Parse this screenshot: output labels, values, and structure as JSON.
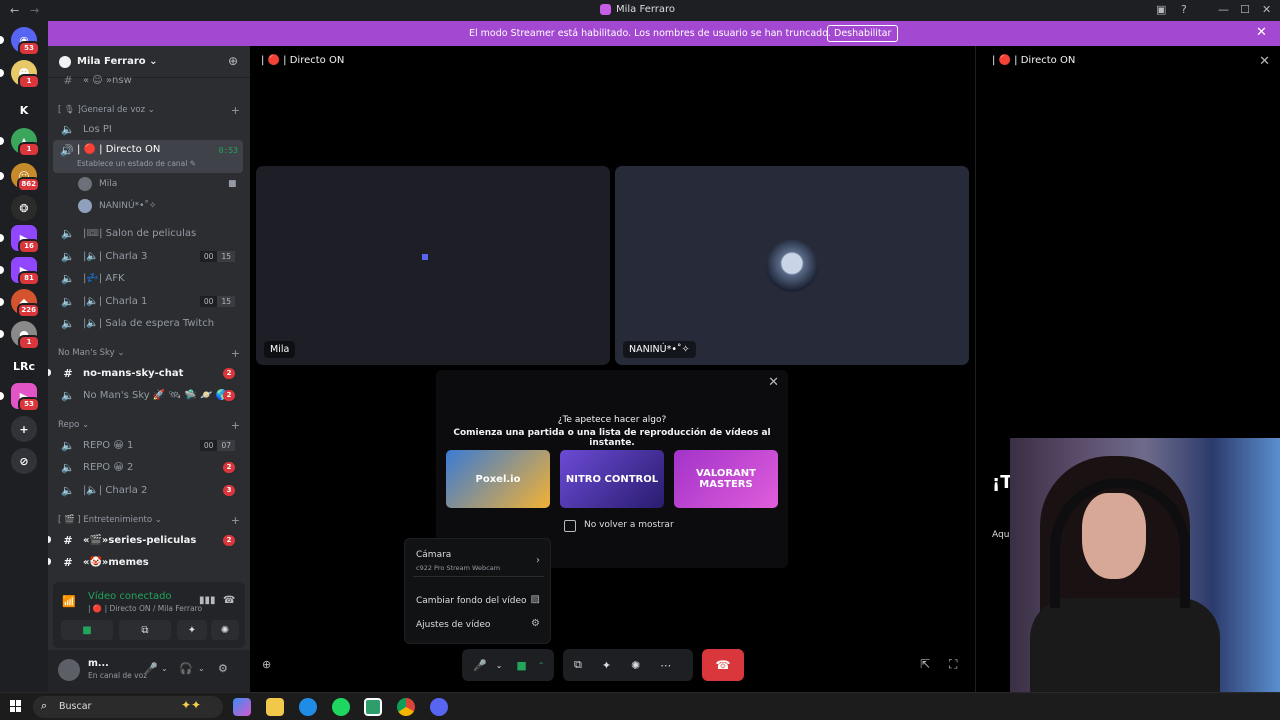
{
  "window": {
    "title": "Mila Ferraro",
    "back": "←",
    "forward": "→",
    "controls": [
      "▣",
      "?",
      "—",
      "☐",
      "✕"
    ]
  },
  "banner": {
    "text": "El modo Streamer está habilitado. Los nombres de usuario se han truncado.",
    "button": "Deshabilitar",
    "close": "✕"
  },
  "guilds": [
    {
      "label": "◉",
      "badge": "53",
      "color": "#5865f2"
    },
    {
      "label": "☻",
      "badge": "1",
      "color": "#e8c96a"
    },
    {
      "label": "K",
      "badge": "",
      "color": "#1e1f22"
    },
    {
      "label": "▲",
      "badge": "1",
      "color": "#3ba55c"
    },
    {
      "label": "☺",
      "badge": "862",
      "color": "#c58b2a"
    },
    {
      "label": "❂",
      "badge": "",
      "color": "#2b2b2b"
    },
    {
      "label": "▶",
      "badge": "16",
      "color": "#9146ff"
    },
    {
      "label": "▶",
      "badge": "81",
      "color": "#9146ff"
    },
    {
      "label": "◆",
      "badge": "226",
      "color": "#d3542e"
    },
    {
      "label": "●",
      "badge": "1",
      "color": "#8a8a8a"
    },
    {
      "label": "LRc",
      "badge": "",
      "color": "#1e1f22"
    },
    {
      "label": "▶",
      "badge": "53",
      "color": "#e355c7"
    },
    {
      "label": "+",
      "badge": "",
      "color": "#313338"
    },
    {
      "label": "⊘",
      "badge": "",
      "color": "#313338"
    }
  ],
  "server": {
    "name": "Mila Ferraro ⌄",
    "add_user": "⊕"
  },
  "channels_top": {
    "partial": "« ☺ »nsw"
  },
  "categories": {
    "general_voz": "[ 🎙 ]General de voz ⌄",
    "no_mans_sky": "No Man's Sky ⌄",
    "repo": "Repo ⌄",
    "entretenimiento": "[ 🎬 ] Entretenimiento ⌄"
  },
  "channels": {
    "los_pi": "Los PI",
    "directo_on": "| 🔴 | Directo ON",
    "directo_status": "Establece un estado de canal ✎",
    "directo_time": "0:53",
    "voice_users": [
      "Mila",
      "NANINÚ*•˚✧"
    ],
    "salon": "|🎟| Salon de peliculas",
    "charla3": "|🔈| Charla 3",
    "charla3_counts": [
      "00",
      "15"
    ],
    "afk": "|💤| AFK",
    "charla1": "|🔈| Charla 1",
    "charla1_counts": [
      "00",
      "15"
    ],
    "sala_espera": "|🔈| Sala de espera Twitch",
    "nms_chat": "no-mans-sky-chat",
    "nms_chat_badge": "2",
    "nms_voice": "No Man's Sky 🚀 🛰 🛸 🪐 🌎",
    "nms_voice_badge": "2",
    "repo1": "REPO 😀 1",
    "repo1_counts": [
      "00",
      "07"
    ],
    "repo2": "REPO 😀 2",
    "repo2_badge": "2",
    "charla2": "|🔈| Charla 2",
    "charla2_badge": "3",
    "series": "«🎬»series-peliculas",
    "series_badge": "2",
    "memes": "«🤡»memes"
  },
  "voice_panel": {
    "status": "Vídeo conectado",
    "channel": "| 🔴 | Directo ON / Mila Ferraro"
  },
  "user": {
    "name": "m...",
    "status": "En canal de voz"
  },
  "stage": {
    "header": "| 🔴 | Directo ON",
    "tiles": [
      "Mila",
      "NANINÚ*•˚✧"
    ]
  },
  "activity": {
    "q1": "¿Te apetece hacer algo?",
    "q2": "Comienza una partida o una lista de reproducción de vídeos al instante.",
    "games": [
      {
        "name": "Poxel.io",
        "color": "#3a7bd5"
      },
      {
        "name": "NITRO CONTROL",
        "color": "#6b4bd6"
      },
      {
        "name": "VALORANT MASTERS",
        "color": "#a233c9"
      }
    ],
    "dont_show": "No volver a mostrar"
  },
  "video_menu": {
    "camera": "Cámara",
    "camera_device": "c922 Pro Stream Webcam",
    "background": "Cambiar fondo del vídeo",
    "settings": "Ajustes de vídeo"
  },
  "chat_panel": {
    "header": "| 🔴 | Directo ON",
    "welcome": "¡T",
    "sub": "Aqu"
  },
  "taskbar": {
    "search": "Buscar"
  }
}
